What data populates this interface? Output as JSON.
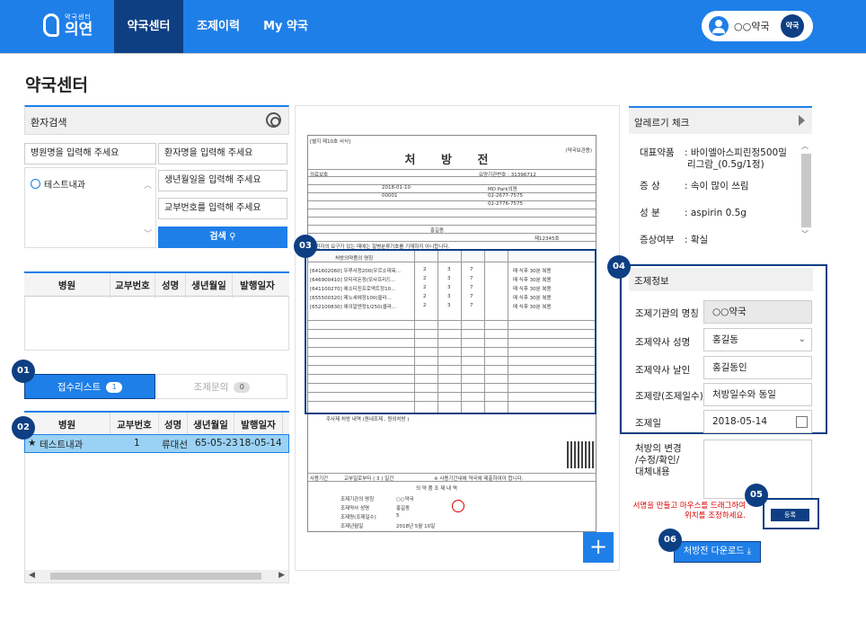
{
  "nav": {
    "logo_sub": "약국센터",
    "logo_main": "의연",
    "items": [
      "약국센터",
      "조제이력",
      "My 약국"
    ],
    "user_name": "○○약국",
    "user_badge": "약국"
  },
  "page_title": "약국센터",
  "patient_search": {
    "title": "환자검색",
    "hospital_placeholder": "병원명을 입력해 주세요",
    "patient_placeholder": "환자명을 입력해 주세요",
    "birth_placeholder": "생년월일을 입력해 주세요",
    "issue_placeholder": "교부번호를 입력해 주세요",
    "hospital_item": "테스트내과",
    "search_button": "검색"
  },
  "table_columns": [
    "병원",
    "교부번호",
    "성명",
    "생년월일",
    "발행일자"
  ],
  "tabs": [
    {
      "label": "접수리스트",
      "count": "1"
    },
    {
      "label": "조제문의",
      "count": "0"
    }
  ],
  "receipt_row": {
    "star": "★",
    "hospital": "테스트내과",
    "issue_no": "1",
    "name": "류대선",
    "birth": "65-05-23",
    "issued": "18-05-14"
  },
  "markers": [
    "01",
    "02",
    "03",
    "04",
    "05",
    "06"
  ],
  "prescription": {
    "form_no": "[별지 제10호 서식]",
    "copy_type": "(약국보관용)",
    "title": "처 방 전",
    "insurance": "의료보호",
    "institution_code_label": "요양기관번호 : 31396712",
    "issue_date": "2018-01-10",
    "issue_no": "00001",
    "clinic": "MD Park의원",
    "phone": "02-2677-7575",
    "fax": "02-2776-7575",
    "doctor": "홍길동",
    "license": "제12345호",
    "notice": "※ 환자의 요구가 있는 때에는 질병분류기호를 기재하지 아니합니다.",
    "drug_header": "처방의약품의 명칭",
    "drugs": [
      {
        "name": "[641602060] 우루사정200(우르소데옥...",
        "dose": "2",
        "freq": "3",
        "days": "7",
        "usage": "매 식후 30분 복용"
      },
      {
        "name": "[646900410] 모티리돈정(모사프리드...",
        "dose": "2",
        "freq": "3",
        "days": "7",
        "usage": "매 식후 30분 복용"
      },
      {
        "name": "[641100270] 에소티진프로액트정10...",
        "dose": "2",
        "freq": "3",
        "days": "7",
        "usage": "매 식후 30분 복용"
      },
      {
        "name": "[655500320] 제노세에정100(클라...",
        "dose": "2",
        "freq": "3",
        "days": "7",
        "usage": "매 식후 30분 복용"
      },
      {
        "name": "[652100830] 에이알엔정1/250(클라...",
        "dose": "2",
        "freq": "3",
        "days": "7",
        "usage": "매 식후 30분 복용"
      }
    ],
    "injection_label": "주사제 처방 내역 (원내조제 , 원외처방 )",
    "usage_period": "사용기간",
    "usage_period_value": "교부일로부터 ( 3 ) 일간",
    "usage_note": "※ 사용기간내에 약국에 제출하여야 합니다.",
    "dispense_section": "의 약 품 조 제 내 역",
    "dispense_org": "조제기관의 명칭",
    "dispense_org_value": "○○약국",
    "dispense_pharmacist": "조제약사 성명",
    "dispense_pharmacist_value": "홍길동",
    "dispense_amount": "조제량(조제일수)",
    "dispense_amount_value": "5",
    "dispense_date": "조제년월일",
    "dispense_date_value": "2018년 5월 10일"
  },
  "allergy": {
    "title": "알레르기 체크",
    "rows": [
      {
        "key": "대표약품",
        "value": ": 바이엘아스피린정500밀"
      },
      {
        "key": "",
        "value": "리그람_(0.5g/1정)"
      },
      {
        "key": "증  상",
        "value": ": 속이 많이 쓰림"
      },
      {
        "key": "성  분",
        "value": ": aspirin 0.5g"
      },
      {
        "key": "증상여부",
        "value": ": 확실"
      }
    ]
  },
  "dispense_info": {
    "title": "조제정보",
    "fields": [
      {
        "label": "조제기관의 명칭",
        "value": "○○약국"
      },
      {
        "label": "조제약사 성명",
        "value": "홍길동"
      },
      {
        "label": "조제약사 날인",
        "value": "홍길동인"
      },
      {
        "label": "조제량(조제일수)",
        "value": "처방일수와 동일"
      },
      {
        "label": "조제일",
        "value": "2018-05-14"
      }
    ],
    "change_label": "처방의 변경\n/수정/확인/\n대체내용",
    "hint": "서명을 만들고 마우스를 드래그하여 위치를 조정하세요.",
    "register_button": "등록",
    "download_button": "처방전 다운로드"
  },
  "colors": {
    "primary": "#1f7fe8",
    "navy": "#0e3f83",
    "selected_row": "#9ad2f5",
    "hint_red": "#dd0000"
  }
}
